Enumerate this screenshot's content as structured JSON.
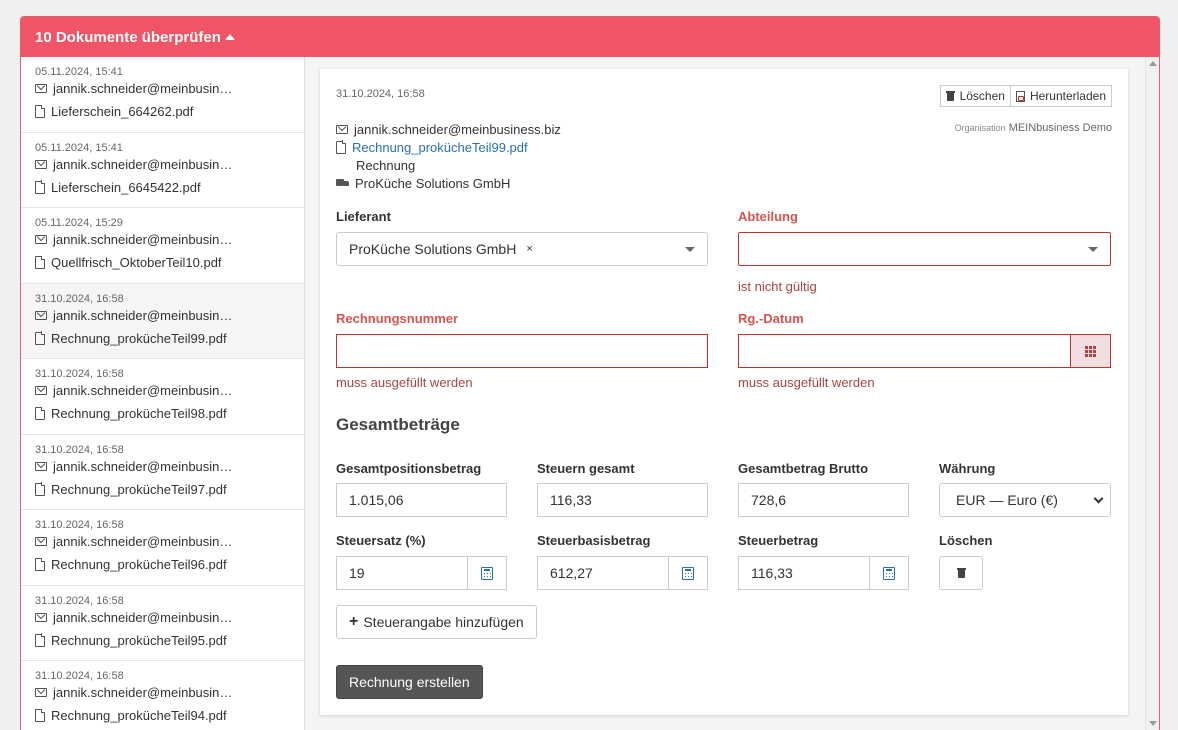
{
  "header": {
    "title": "10 Dokumente überprüfen"
  },
  "documents": [
    {
      "date": "05.11.2024, 15:41",
      "email": "jannik.schneider@meinbusin…",
      "file": "Lieferschein_664262.pdf"
    },
    {
      "date": "05.11.2024, 15:41",
      "email": "jannik.schneider@meinbusin…",
      "file": "Lieferschein_6645422.pdf"
    },
    {
      "date": "05.11.2024, 15:29",
      "email": "jannik.schneider@meinbusin…",
      "file": "Quellfrisch_OktoberTeil10.pdf"
    },
    {
      "date": "31.10.2024, 16:58",
      "email": "jannik.schneider@meinbusin…",
      "file": "Rechnung_proküchеTeil99.pdf"
    },
    {
      "date": "31.10.2024, 16:58",
      "email": "jannik.schneider@meinbusin…",
      "file": "Rechnung_proküchеTeil98.pdf"
    },
    {
      "date": "31.10.2024, 16:58",
      "email": "jannik.schneider@meinbusin…",
      "file": "Rechnung_proküchеTeil97.pdf"
    },
    {
      "date": "31.10.2024, 16:58",
      "email": "jannik.schneider@meinbusin…",
      "file": "Rechnung_proküchеTeil96.pdf"
    },
    {
      "date": "31.10.2024, 16:58",
      "email": "jannik.schneider@meinbusin…",
      "file": "Rechnung_proküchеTeil95.pdf"
    },
    {
      "date": "31.10.2024, 16:58",
      "email": "jannik.schneider@meinbusin…",
      "file": "Rechnung_proküchеTeil94.pdf"
    }
  ],
  "detail": {
    "date": "31.10.2024, 16:58",
    "delete_label": "Löschen",
    "download_label": "Herunterladen",
    "org_label": "Organisation",
    "org_name": "MEINbusiness Demo",
    "email": "jannik.schneider@meinbusiness.biz",
    "file": "Rechnung_proküchеTeil99.pdf",
    "type": "Rechnung",
    "supplier": "ProKüche Solutions GmbH"
  },
  "form": {
    "lieferant_label": "Lieferant",
    "lieferant_value": "ProKüche Solutions GmbH",
    "lieferant_clear": "×",
    "abteilung_label": "Abteilung",
    "abteilung_error": "ist nicht gültig",
    "rechnungsnummer_label": "Rechnungsnummer",
    "rechnungsnummer_error": "muss ausgefüllt werden",
    "datum_label": "Rg.-Datum",
    "datum_error": "muss ausgefüllt werden"
  },
  "totals": {
    "section_title": "Gesamtbeträge",
    "positions_label": "Gesamtpositionsbetrag",
    "positions_value": "1.015,06",
    "taxes_label": "Steuern gesamt",
    "taxes_value": "116,33",
    "gross_label": "Gesamtbetrag Brutto",
    "gross_value": "728,6",
    "currency_label": "Währung",
    "currency_value": "EUR — Euro (€)",
    "rate_label": "Steuersatz (%)",
    "rate_value": "19",
    "base_label": "Steuerbasisbetrag",
    "base_value": "612,27",
    "tax_label": "Steuerbetrag",
    "tax_value": "116,33",
    "delete_label": "Löschen"
  },
  "buttons": {
    "add_tax": "Steuerangabe hinzufügen",
    "create_invoice": "Rechnung erstellen"
  }
}
